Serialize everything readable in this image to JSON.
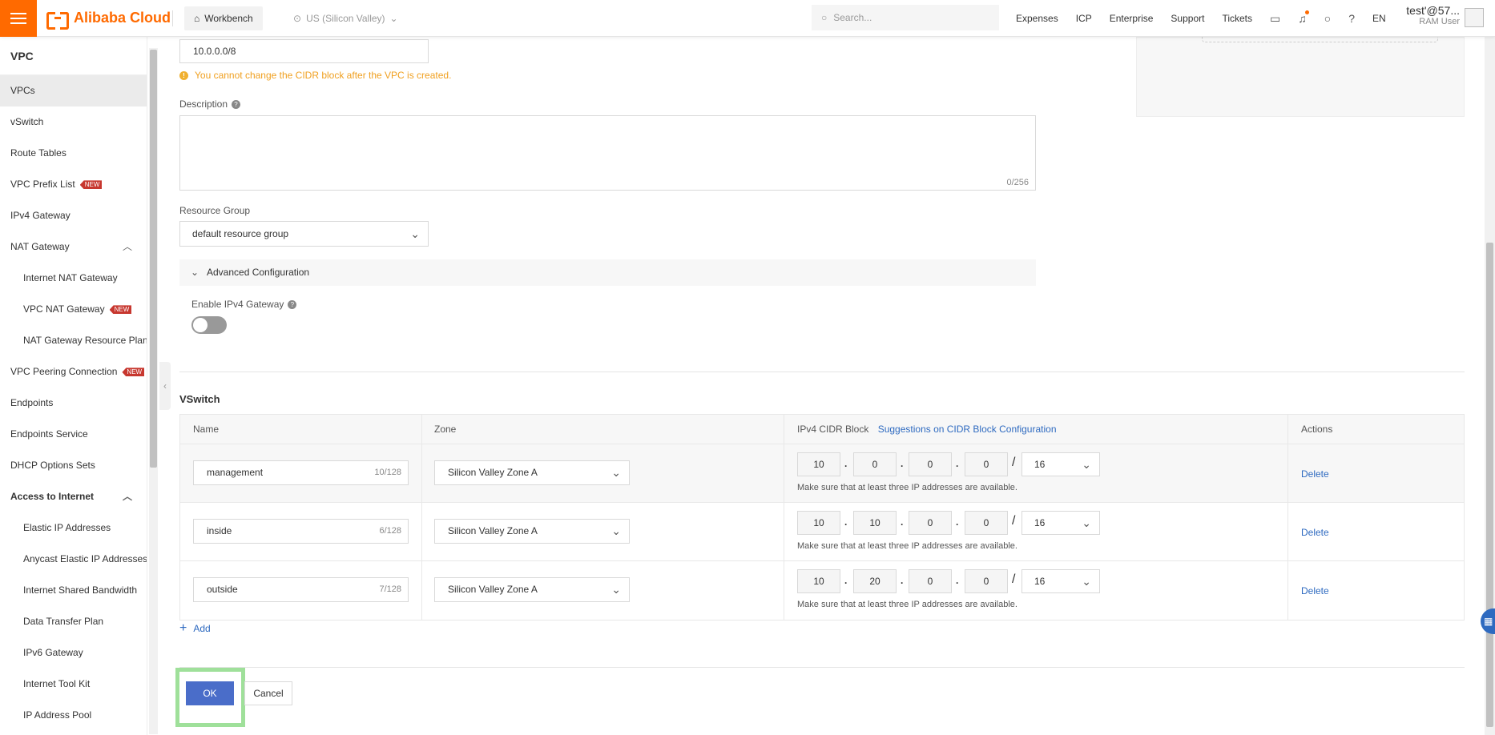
{
  "topbar": {
    "brand": "Alibaba Cloud",
    "workbench": "Workbench",
    "region": "US (Silicon Valley)",
    "search_placeholder": "Search...",
    "nav": [
      "Expenses",
      "ICP",
      "Enterprise",
      "Support",
      "Tickets"
    ],
    "lang": "EN",
    "user_name": "test'@57...",
    "user_role": "RAM User"
  },
  "sidebar": {
    "title": "VPC",
    "items": [
      {
        "label": "VPCs"
      },
      {
        "label": "vSwitch"
      },
      {
        "label": "Route Tables"
      },
      {
        "label": "VPC Prefix List",
        "badge": "NEW"
      },
      {
        "label": "IPv4 Gateway"
      },
      {
        "label": "NAT Gateway"
      },
      {
        "label": "Internet NAT Gateway"
      },
      {
        "label": "VPC NAT Gateway",
        "badge": "NEW"
      },
      {
        "label": "NAT Gateway Resource Plan"
      },
      {
        "label": "VPC Peering Connection",
        "badge": "NEW"
      },
      {
        "label": "Endpoints"
      },
      {
        "label": "Endpoints Service"
      },
      {
        "label": "DHCP Options Sets"
      },
      {
        "label": "Access to Internet"
      },
      {
        "label": "Elastic IP Addresses"
      },
      {
        "label": "Anycast Elastic IP Addresses"
      },
      {
        "label": "Internet Shared Bandwidth"
      },
      {
        "label": "Data Transfer Plan"
      },
      {
        "label": "IPv6 Gateway"
      },
      {
        "label": "Internet Tool Kit"
      },
      {
        "label": "IP Address Pool"
      }
    ]
  },
  "form": {
    "cidr_value": "10.0.0.0/8",
    "cidr_warning": "You cannot change the CIDR block after the VPC is created.",
    "description_label": "Description",
    "description_count": "0/256",
    "resource_group_label": "Resource Group",
    "resource_group_value": "default resource group",
    "advanced_label": "Advanced Configuration",
    "ipv4_gateway_label": "Enable IPv4 Gateway",
    "ipv4_gateway_enabled": false
  },
  "vswitch": {
    "title": "VSwitch",
    "headers": {
      "name": "Name",
      "zone": "Zone",
      "cidr": "IPv4 CIDR Block",
      "cidr_link": "Suggestions on CIDR Block Configuration",
      "actions": "Actions"
    },
    "rows": [
      {
        "name": "management",
        "count": "10/128",
        "zone": "Silicon Valley Zone A",
        "ip": [
          "10",
          "0",
          "0",
          "0"
        ],
        "mask": "16",
        "hint": "Make sure that at least three IP addresses are available.",
        "action": "Delete"
      },
      {
        "name": "inside",
        "count": "6/128",
        "zone": "Silicon Valley Zone A",
        "ip": [
          "10",
          "10",
          "0",
          "0"
        ],
        "mask": "16",
        "hint": "Make sure that at least three IP addresses are available.",
        "action": "Delete"
      },
      {
        "name": "outside",
        "count": "7/128",
        "zone": "Silicon Valley Zone A",
        "ip": [
          "10",
          "20",
          "0",
          "0"
        ],
        "mask": "16",
        "hint": "Make sure that at least three IP addresses are available.",
        "action": "Delete"
      }
    ],
    "add_label": "Add"
  },
  "footer": {
    "ok": "OK",
    "cancel": "Cancel"
  },
  "colors": {
    "brand": "#ff6a00",
    "primary": "#4a6dc9",
    "link": "#2e6ac0",
    "warning": "#f0a020",
    "highlight": "#9fe09a",
    "badge": "#c7372f"
  }
}
